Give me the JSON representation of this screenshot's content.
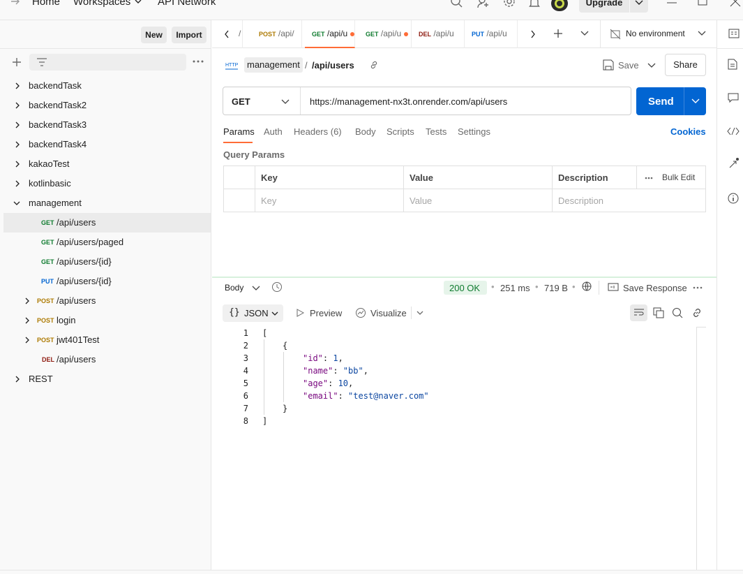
{
  "topbar": {
    "home": "Home",
    "workspaces": "Workspaces",
    "api_network": "API Network",
    "upgrade": "Upgrade"
  },
  "sidebar": {
    "new_label": "New",
    "import_label": "Import",
    "collections": [
      {
        "name": "backendTask"
      },
      {
        "name": "backendTask2"
      },
      {
        "name": "backendTask3"
      },
      {
        "name": "backendTask4"
      },
      {
        "name": "kakaoTest"
      },
      {
        "name": "kotlinbasic"
      },
      {
        "name": "management"
      }
    ],
    "management_items": [
      {
        "method": "GET",
        "path": "/api/users"
      },
      {
        "method": "GET",
        "path": "/api/users/paged"
      },
      {
        "method": "GET",
        "path": "/api/users/{id}"
      },
      {
        "method": "PUT",
        "path": "/api/users/{id}"
      },
      {
        "method": "POST",
        "path": "/api/users"
      },
      {
        "method": "POST",
        "path": "login"
      },
      {
        "method": "POST",
        "path": "jwt401Test"
      },
      {
        "method": "DEL",
        "path": "/api/users"
      }
    ],
    "rest": "REST"
  },
  "tabs": [
    {
      "method": "POST",
      "label": "/api/"
    },
    {
      "method": "GET",
      "label": "/api/u"
    },
    {
      "method": "GET",
      "label": "/api/u"
    },
    {
      "method": "DEL",
      "label": "/api/u"
    },
    {
      "method": "PUT",
      "label": "/api/u"
    }
  ],
  "environment": "No environment",
  "request": {
    "collection": "management",
    "separator": "/",
    "name": "/api/users",
    "save_label": "Save",
    "share_label": "Share",
    "method": "GET",
    "url": "https://management-nx3t.onrender.com/api/users",
    "send_label": "Send",
    "tabs": [
      "Params",
      "Auth",
      "Headers (6)",
      "Body",
      "Scripts",
      "Tests",
      "Settings"
    ],
    "cookies": "Cookies",
    "query_params_title": "Query Params",
    "columns": [
      "Key",
      "Value",
      "Description"
    ],
    "bulk_edit": "Bulk Edit",
    "placeholders": {
      "key": "Key",
      "value": "Value",
      "description": "Description"
    }
  },
  "response": {
    "body_label": "Body",
    "status": "200 OK",
    "time": "251 ms",
    "size": "719 B",
    "save_response": "Save Response",
    "format": "JSON",
    "preview": "Preview",
    "visualize": "Visualize",
    "line_numbers": [
      "1",
      "2",
      "3",
      "4",
      "5",
      "6",
      "7",
      "8"
    ],
    "json": {
      "open_bracket": "[",
      "open_brace": "{",
      "fields": [
        {
          "key": "\"id\"",
          "value": "1",
          "type": "number",
          "comma": ","
        },
        {
          "key": "\"name\"",
          "value": "\"bb\"",
          "type": "string",
          "comma": ","
        },
        {
          "key": "\"age\"",
          "value": "10",
          "type": "number",
          "comma": ","
        },
        {
          "key": "\"email\"",
          "value": "\"test@naver.com\"",
          "type": "string",
          "comma": ""
        }
      ],
      "close_brace": "}",
      "close_bracket": "]"
    }
  },
  "colors": {
    "accent_orange": "#ff6c37",
    "send_blue": "#0265d2",
    "get_green": "#0f7b2f",
    "post_yellow": "#ad7a03",
    "status_green": "#0f7b2f"
  }
}
